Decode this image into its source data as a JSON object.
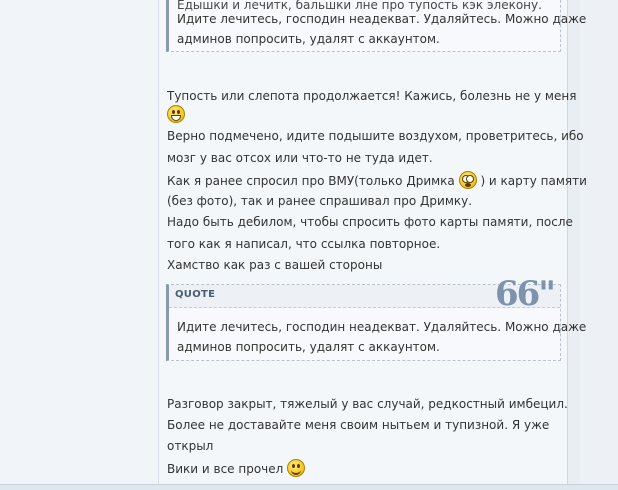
{
  "quote_top": {
    "line_partial": "Едышки и лечитк, бальшки лне про тупость кэк элекону.",
    "line1": "Идите лечитесь, господин неадекват. Удаляйтесь. Можно даже",
    "line2": "админов попросить, удалят с аккаунтом."
  },
  "post": {
    "p1_line1": "Тупость или слепота продолжается! Кажись, болезнь не у меня",
    "p1_line3": "Верно подмечено, идите подышите воздухом, проветритесь, ибо",
    "p1_line4": "мозг у вас отсох или что-то не туда идет.",
    "p1_line5a": "Как я ранее спросил про ВМУ(только Дримка",
    "p1_line5b": ") и карту памяти",
    "p1_line6": "(без фото), так и ранее спрашивал про Дримку.",
    "p1_line7": "Надо быть дебилом, чтобы спросить фото карты памяти, после",
    "p1_line8": "того как я написал, что ссылка повторное.",
    "p1_line9": "Хамство как раз с вашей стороны"
  },
  "quote": {
    "label": "QUOTE",
    "marks": "66\"",
    "line1": "Идите лечитесь, господин неадекват. Удаляйтесь. Можно даже",
    "line2": "админов попросить, удалят с аккаунтом."
  },
  "post2": {
    "line1": "Разговор закрыт, тяжелый у вас случай, редкостный имбецил.",
    "line2": "Более не доставайте меня своим нытьем и тупизной. Я уже",
    "line3": "открыл",
    "line4": "Вики и все прочел"
  },
  "icons": [
    "laughing-smiley-icon",
    "shocked-smiley-icon",
    "smiley-icon"
  ]
}
